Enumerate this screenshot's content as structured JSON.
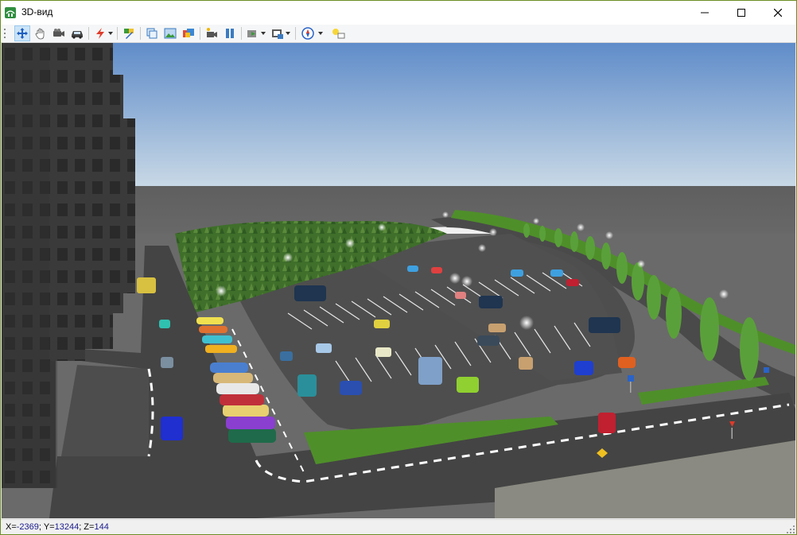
{
  "window": {
    "title": "3D-вид",
    "controls": [
      "minimize",
      "maximize",
      "close"
    ]
  },
  "toolbar": {
    "buttons": [
      {
        "icon": "move-arrows-icon",
        "active": true
      },
      {
        "icon": "hand-pan-icon"
      },
      {
        "icon": "camera-icon"
      },
      {
        "icon": "car-icon"
      },
      {
        "icon": "lightning-icon",
        "dropdown": true
      },
      {
        "icon": "paint-brush-icon"
      },
      {
        "icon": "copy-view-icon"
      },
      {
        "icon": "image-icon"
      },
      {
        "icon": "textures-icon"
      },
      {
        "icon": "record-icon"
      },
      {
        "icon": "pause-icon"
      },
      {
        "icon": "play-animation-icon",
        "dropdown": true
      },
      {
        "icon": "save-video-icon",
        "dropdown": true
      },
      {
        "icon": "compass-icon",
        "dropdown": true
      },
      {
        "icon": "light-bulb-icon"
      }
    ]
  },
  "status": {
    "x_label": "X=",
    "x_value": "-2369",
    "y_label": "; Y=",
    "y_value": "13244",
    "z_label": "; Z=",
    "z_value": "144"
  },
  "colors": {
    "sky_top": "#5f8cc9",
    "sky_bottom": "#c9d9e6",
    "sea": "#6b6b6b",
    "asphalt": "#4e4e4e",
    "grass": "#4f8f2a",
    "accent": "#3c8c3c"
  }
}
